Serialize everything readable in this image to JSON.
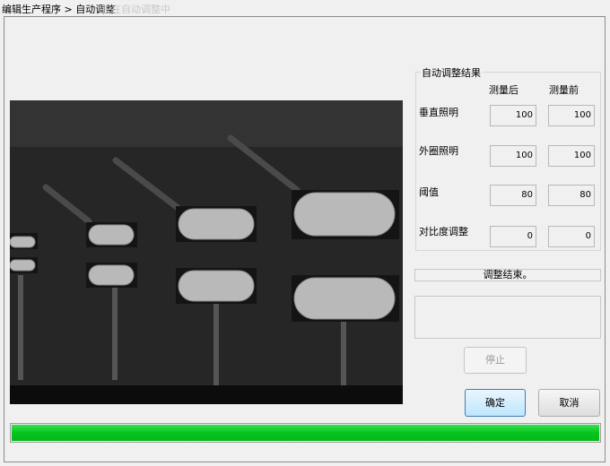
{
  "window": {
    "title": "编辑生产程序 > 自动调整",
    "title_faded": "正在自动调整中"
  },
  "group": {
    "title": "自动调整结果",
    "col_after": "测量后",
    "col_before": "测量前",
    "rows": [
      {
        "label": "垂直照明",
        "after": "100",
        "before": "100"
      },
      {
        "label": "外圈照明",
        "after": "100",
        "before": "100"
      },
      {
        "label": "阈值",
        "after": "80",
        "before": "80"
      },
      {
        "label": "对比度调整",
        "after": "0",
        "before": "0"
      }
    ]
  },
  "status": {
    "text": "调整结束。"
  },
  "buttons": {
    "stop": "停止",
    "ok": "确定",
    "cancel": "取消"
  },
  "progress": {
    "value": 1.0,
    "color": "#06c41d"
  }
}
